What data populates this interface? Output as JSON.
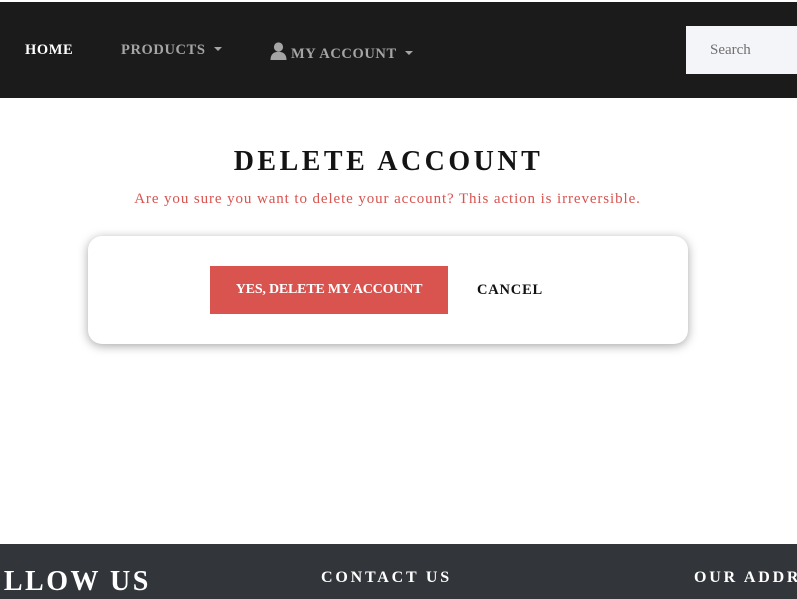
{
  "navbar": {
    "home_label": "HOME",
    "products_label": "PRODUCTS",
    "account_label": "MY ACCOUNT",
    "account_icon": "user-icon",
    "dropdown_icon": "caret-down-icon",
    "search_placeholder": "Search"
  },
  "main": {
    "title": "DELETE ACCOUNT",
    "warning": "Are you sure you want to delete your account? This action is irreversible.",
    "confirm_label": "YES, DELETE MY ACCOUNT",
    "cancel_label": "CANCEL"
  },
  "footer": {
    "follow_label": "FOLLOW US",
    "contact_label": "CONTACT US",
    "address_label": "OUR ADDRESS"
  },
  "colors": {
    "navbar_bg": "#1b1b1c",
    "footer_bg": "#32353a",
    "danger": "#d9534f",
    "nav_active": "#ffffff",
    "nav_inactive": "#a5a5a5"
  }
}
